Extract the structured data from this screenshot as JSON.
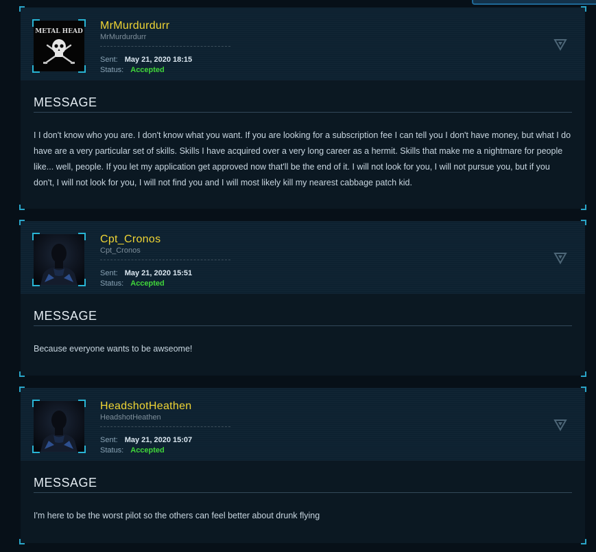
{
  "cards": [
    {
      "username": "MrMurdurdurr",
      "handle": "MrMurdurdurr",
      "sent_label": "Sent:",
      "sent_value": "May 21, 2020 18:15",
      "status_label": "Status:",
      "status_value": "Accepted",
      "avatar_text": "METAL HEAD",
      "message_title": "MESSAGE",
      "message": "I I don't know who you are. I don't know what you want. If you are looking for a subscription fee I can tell you I don't have money, but what I do have are a very particular set of skills. Skills I have acquired over a very long career as a hermit. Skills that make me a nightmare for people like... well, people. If you let my application get approved now that'll be the end of it. I will not look for you, I will not pursue you, but if you don't, I will not look for you, I will not find you and I will most likely kill my nearest cabbage patch kid."
    },
    {
      "username": "Cpt_Cronos",
      "handle": "Cpt_Cronos",
      "sent_label": "Sent:",
      "sent_value": "May 21, 2020 15:51",
      "status_label": "Status:",
      "status_value": "Accepted",
      "message_title": "MESSAGE",
      "message": "Because everyone wants to be awseome!"
    },
    {
      "username": "HeadshotHeathen",
      "handle": "HeadshotHeathen",
      "sent_label": "Sent:",
      "sent_value": "May 21, 2020 15:07",
      "status_label": "Status:",
      "status_value": "Accepted",
      "message_title": "MESSAGE",
      "message": "I'm here to be the worst pilot so the others can feel better about drunk flying"
    }
  ],
  "icons": {
    "toggle": "chevron-down-triangle-icon",
    "avatar_default": "pilot-silhouette-icon",
    "avatar_custom": "skull-avatar-icon"
  },
  "colors": {
    "username": "#f0d534",
    "accepted": "#41d63a",
    "accent": "#2aa6c9"
  }
}
